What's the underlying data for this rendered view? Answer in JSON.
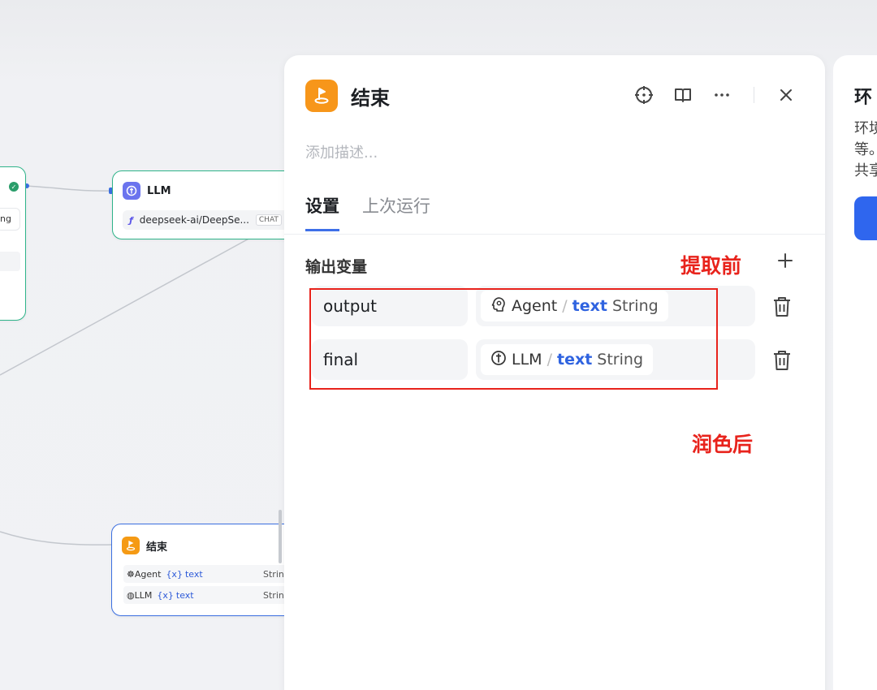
{
  "canvas": {
    "left_node": {
      "field_fragment": "ng"
    },
    "llm_node": {
      "title": "LLM",
      "model": "deepseek-ai/DeepSe...",
      "model_tag": "CHAT"
    },
    "end_node": {
      "title": "结束",
      "rows": [
        {
          "source": "Agent",
          "var_prefix": "{x}",
          "var": "text",
          "type": "Strin"
        },
        {
          "source": "LLM",
          "var_prefix": "{x}",
          "var": "text",
          "type": "Strin"
        }
      ]
    }
  },
  "panel": {
    "title": "结束",
    "description_placeholder": "添加描述...",
    "tabs": [
      {
        "label": "设置",
        "active": true
      },
      {
        "label": "上次运行",
        "active": false
      }
    ],
    "section_title": "输出变量",
    "outputs": [
      {
        "name": "output",
        "source": "Agent",
        "separator": "/",
        "var": "text",
        "type": "String"
      },
      {
        "name": "final",
        "source": "LLM",
        "separator": "/",
        "var": "text",
        "type": "String"
      }
    ]
  },
  "annotations": {
    "before": "提取前",
    "after": "润色后"
  },
  "side_panel": {
    "title": "环",
    "text_lines": [
      "环境",
      "等。",
      "共享"
    ]
  },
  "colors": {
    "accent": "#3e6fe8",
    "end_icon": "#f7961a",
    "llm_icon": "#6b74ee",
    "annotation": "#e8231c",
    "node_border": "#2fb48a"
  }
}
